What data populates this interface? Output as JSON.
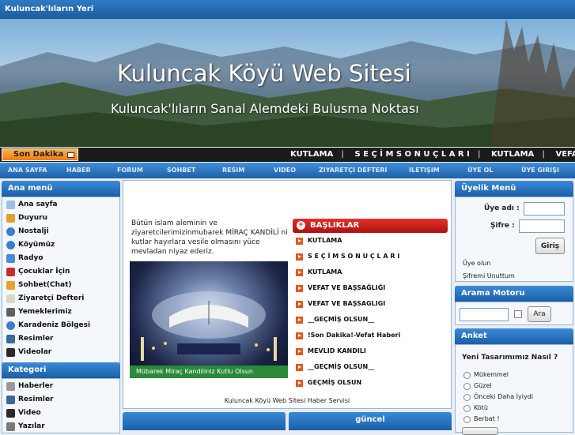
{
  "site_title": "Kuluncak'lıların Yeri",
  "banner": {
    "title": "Kuluncak Köyü Web Sitesi",
    "subtitle": "Kuluncak'lıların Sanal Alemdeki Bulusma Noktası"
  },
  "ticker": {
    "label": "Son Dakika",
    "items": [
      "KUTLAMA",
      "S E Ç İ M S O N U Ç L A R I",
      "KUTLAMA",
      "VEFAT V"
    ]
  },
  "nav": [
    "ANA SAYFA",
    "HABER",
    "FORUM",
    "SOHBET",
    "RESIM",
    "VIDEO",
    "ZIYARETÇI DEFTERI",
    "ILETIŞIM",
    "ÜYE OL",
    "ÜYE GIRIŞI"
  ],
  "main_menu": {
    "title": "Ana menü",
    "items": [
      "Ana sayfa",
      "Duyuru",
      "Nostalji",
      "Köyümüz",
      "Radyo",
      "Çocuklar İçin",
      "Sohbet(Chat)",
      "Ziyaretçi Defteri",
      "Yemeklerimiz",
      "Karadeniz Bölgesi",
      "Resimler",
      "Videolar"
    ]
  },
  "category": {
    "title": "Kategori",
    "items": [
      "Haberler",
      "Resimler",
      "Video",
      "Yazılar"
    ]
  },
  "center": {
    "intro": "Bütün islam aleminin ve ziyaretcilerimizinmubarek MİRAÇ KANDİLİ ni kutlar hayırlara vesile olmasını yüce mevladan niyaz ederiz.",
    "photo_caption": "Mübarek Miraç Kandiliniz Kutlu Olsun",
    "headlines_title": "BAŞLIKLAR",
    "headlines": [
      "KUTLAMA",
      "S E Ç İ M S O N U Ç L A R I",
      "KUTLAMA",
      "VEFAT VE BAŞSAĞLIĞI",
      "VEFAT VE BAŞSAGLIGI",
      "__GEÇMİŞ OLSUN__",
      "!Son Dakika!-Vefat Haberi",
      "MEVLID KANDILI",
      "__GEÇMİŞ OLSUN__",
      "GEÇMİŞ OLSUN"
    ],
    "footer": "Kuluncak Köyü Web Sitesi Haber Servisi"
  },
  "bottom_center": {
    "right_title": "güncel"
  },
  "login": {
    "title": "Üyelik Menü",
    "username_label": "Üye adı :",
    "password_label": "Şifre :",
    "submit": "Giriş",
    "register": "Üye olun",
    "forgot": "Şifremi Unuttum"
  },
  "search": {
    "title": "Arama Motoru",
    "button": "Ara"
  },
  "poll": {
    "title": "Anket",
    "question": "Yeni Tasarımımız Nasıl ?",
    "options": [
      "Mükemmel",
      "Güzel",
      "Önceki Daha İyiydi",
      "Kötü",
      "Berbat !"
    ]
  },
  "colors": {
    "header_blue": "#1c5fa8",
    "accent_orange": "#f07b12",
    "headline_red": "#c4201a"
  }
}
